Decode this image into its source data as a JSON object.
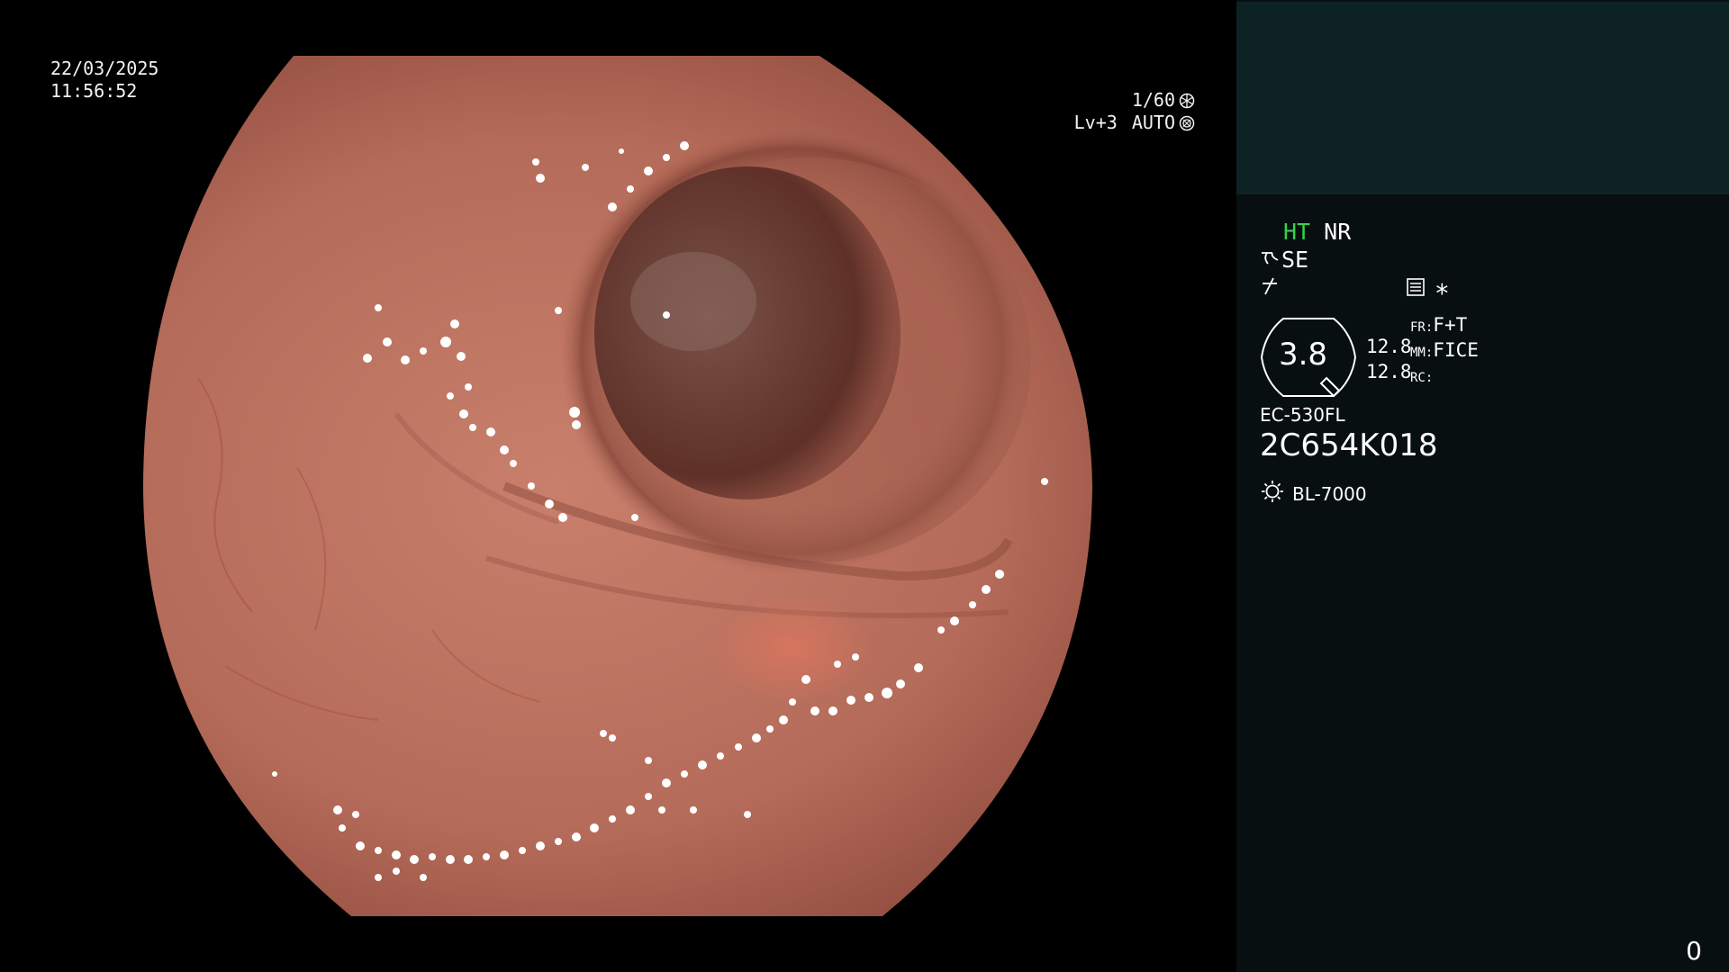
{
  "overlay": {
    "date": "22/03/2025",
    "time": "11:56:52",
    "shutter": "1/60",
    "shutter_icon": "aperture-icon",
    "iris_level": "Lv+3",
    "iris_mode": "AUTO",
    "iris_icon": "iris-icon"
  },
  "panel": {
    "mode_ht": "HT",
    "mode_nr": "NR",
    "enhance": "SE",
    "enhance_icon": "structure-enhance-icon",
    "color_icon": "color-mode-icon",
    "record_icon": "record-settings-icon",
    "asterisk": "∗",
    "zoom": "3.8",
    "params": [
      "12.8",
      "12.8"
    ],
    "labels": [
      {
        "key": "FR:",
        "value": "F+T"
      },
      {
        "key": "MM:",
        "value": "FICE"
      },
      {
        "key": "RC:",
        "value": ""
      }
    ],
    "scope_model": "EC-530FL",
    "scope_serial": "2C654K018",
    "light_source": "BL-7000",
    "light_icon": "light-source-icon",
    "counter": "0"
  },
  "colors": {
    "panel_bg": "#080f10",
    "panel_top_box": "#0d2225",
    "ht_green": "#35d24b",
    "mucosa": "#b86a58"
  }
}
